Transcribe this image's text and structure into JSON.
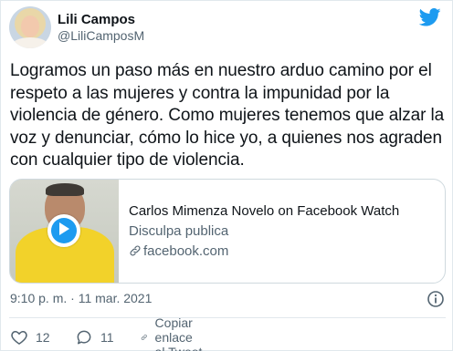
{
  "author": {
    "name": "Lili Campos",
    "handle": "@LiliCamposM"
  },
  "brand": {
    "icon": "twitter-bird-icon",
    "color": "#1d9bf0"
  },
  "tweet": {
    "lines": [
      "Logramos un paso más en nuestro arduo camino por el",
      "respeto a las mujeres y contra la impunidad por la",
      "violencia de género. Como mujeres tenemos que alzar la",
      "voz y denunciar, cómo lo hice yo, a quienes nos agraden",
      "con cualquier tipo de violencia."
    ]
  },
  "card": {
    "title": "Carlos Mimenza Novelo on Facebook Watch",
    "description": "Disculpa publica",
    "domain": "facebook.com",
    "thumbnail_icon": "video-thumbnail",
    "play_icon": "play-icon"
  },
  "meta": {
    "timestamp": "9:10 p. m. · 11 mar. 2021"
  },
  "actions": {
    "likes": "12",
    "replies": "11",
    "copy_link": "Copiar enlace al Tweet"
  },
  "colors": {
    "text": "#0f1419",
    "secondary": "#536471",
    "border": "#cfd9de"
  }
}
